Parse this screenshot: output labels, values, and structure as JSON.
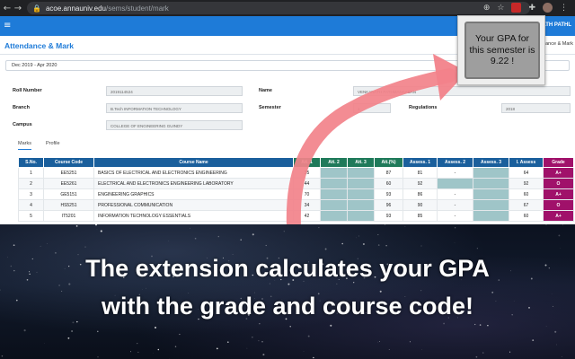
{
  "browser": {
    "url_host": "acoe.annauniv.edu",
    "url_path": "/sems/student/mark"
  },
  "app": {
    "menu_icon": "hamburger-icon",
    "user_name": "...KANATH PATHL",
    "page_title": "Attendance & Mark",
    "breadcrumb": "Attendance & Mark"
  },
  "filters": {
    "semester": "Dec 2019 - Apr 2020"
  },
  "profile": {
    "roll_label": "Roll Number",
    "roll_value": "2019114524",
    "name_label": "Name",
    "name_value": "VENKANATH PATHMANAABAN",
    "branch_label": "Branch",
    "branch_value": "B.Tech INFORMATION TECHNOLOGY",
    "semester_label": "Semester",
    "semester_value": "1",
    "regulations_label": "Regulations",
    "regulations_value": "2018",
    "campus_label": "Campus",
    "campus_value": "COLLEGE OF ENGINEERING GUINDY"
  },
  "tabs": [
    {
      "label": "Marks"
    },
    {
      "label": "Profile"
    }
  ],
  "table": {
    "columns": [
      "S.No.",
      "Course Code",
      "Course Name",
      "Att. 1",
      "Att. 2",
      "Att. 3",
      "Att.(%)",
      "Assess. 1",
      "Assess. 2",
      "Assess. 3",
      "I. Assess",
      "Grade"
    ],
    "header_colors": {
      "primary": "#1a5f9c",
      "attendance": "#1f7a5a",
      "grade": "#a0116a"
    },
    "rows": [
      {
        "sno": "1",
        "code": "EE5251",
        "name": "BASICS OF ELECTRICAL AND ELECTRONICS ENGINEERING",
        "att1": "35",
        "att2": "",
        "att3": "",
        "attp": "87",
        "a1": "81",
        "a2": "-",
        "a3": "",
        "ia": "64",
        "grade": "A+"
      },
      {
        "sno": "2",
        "code": "EE5261",
        "name": "ELECTRICAL AND ELECTRONICS ENGINEERING LABORATORY",
        "att1": "44",
        "att2": "",
        "att3": "",
        "attp": "60",
        "a1": "92",
        "a2": "",
        "a3": "",
        "ia": "92",
        "grade": "O"
      },
      {
        "sno": "3",
        "code": "GE5151",
        "name": "ENGINEERING GRAPHICS",
        "att1": "70",
        "att2": "",
        "att3": "",
        "attp": "93",
        "a1": "86",
        "a2": "-",
        "a3": "",
        "ia": "60",
        "grade": "A+"
      },
      {
        "sno": "4",
        "code": "HS5251",
        "name": "PROFESSIONAL COMMUNICATION",
        "att1": "34",
        "att2": "",
        "att3": "",
        "attp": "96",
        "a1": "90",
        "a2": "-",
        "a3": "",
        "ia": "67",
        "grade": "O"
      },
      {
        "sno": "5",
        "code": "IT5201",
        "name": "INFORMATION TECHNOLOGY ESSENTIALS",
        "att1": "42",
        "att2": "",
        "att3": "",
        "attp": "93",
        "a1": "85",
        "a2": "-",
        "a3": "",
        "ia": "60",
        "grade": "A+"
      }
    ]
  },
  "gpa_popup": {
    "text": "Your GPA for this semester is 9.22 !"
  },
  "banner": {
    "line1": "The extension calculates your GPA",
    "line2": "with the grade and course code!"
  },
  "colors": {
    "app_blue": "#1e7bd8",
    "grade_magenta": "#a0116a",
    "arrow_pink": "#f2828a"
  }
}
